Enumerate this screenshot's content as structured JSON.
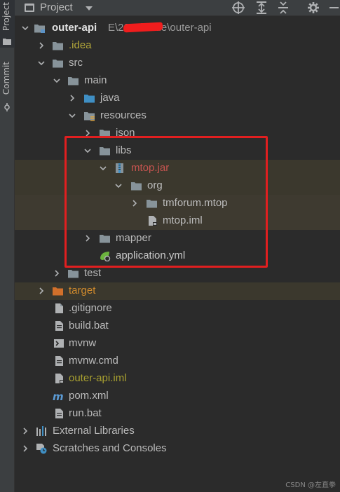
{
  "sidebar": {
    "project_tab": "Project",
    "commit_tab": "Commit"
  },
  "header": {
    "title": "Project"
  },
  "root": {
    "name": "outer-api",
    "path": "E\\2024\\code\\outer-api"
  },
  "tree": [
    {
      "label": ".idea",
      "color": "#b4a83a"
    },
    {
      "label": "src"
    },
    {
      "label": "main"
    },
    {
      "label": "java"
    },
    {
      "label": "resources"
    },
    {
      "label": "json"
    },
    {
      "label": "libs"
    },
    {
      "label": "mtop.jar",
      "color": "#c75450"
    },
    {
      "label": "org"
    },
    {
      "label": "tmforum.mtop"
    },
    {
      "label": "mtop.iml"
    },
    {
      "label": "mapper"
    },
    {
      "label": "application.yml"
    },
    {
      "label": "test"
    },
    {
      "label": "target",
      "color": "#d08a2d"
    },
    {
      "label": ".gitignore"
    },
    {
      "label": "build.bat"
    },
    {
      "label": "mvnw"
    },
    {
      "label": "mvnw.cmd"
    },
    {
      "label": "outer-api.iml",
      "color": "#a8a030"
    },
    {
      "label": "pom.xml"
    },
    {
      "label": "run.bat"
    },
    {
      "label": "External Libraries"
    },
    {
      "label": "Scratches and Consoles"
    }
  ],
  "icons": [
    "project-icon",
    "dropdown-icon",
    "locate-icon",
    "expand-all-icon",
    "collapse-all-icon",
    "gear-icon",
    "minimize-icon",
    "folder-icon",
    "chevron-right-icon",
    "chevron-down-icon"
  ],
  "watermark": "CSDN @左直拳"
}
